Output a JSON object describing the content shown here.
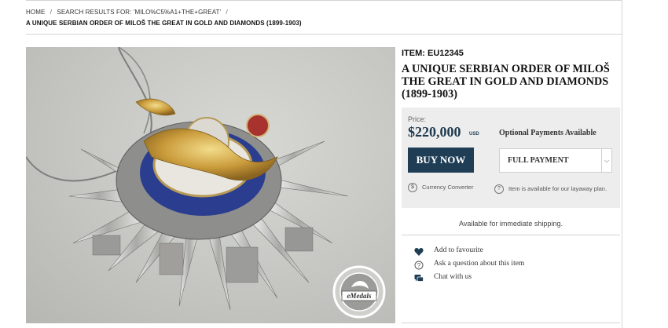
{
  "breadcrumb": {
    "home": "HOME",
    "separator": "/",
    "search": "SEARCH RESULTS FOR: 'MILO%C5%A1+THE+GREAT'",
    "current": "A UNIQUE SERBIAN ORDER OF MILOŠ THE GREAT IN GOLD AND DIAMONDS (1899-1903)"
  },
  "product": {
    "item_id": "ITEM: EU12345",
    "title": "A UNIQUE SERBIAN ORDER OF MILOŠ THE GREAT IN GOLD AND DIAMONDS (1899-1903)",
    "watermark": "eMedals"
  },
  "purchase": {
    "price_label": "Price:",
    "price": "$220,000",
    "currency": "USD",
    "optional_label": "Optional Payments Available",
    "buy_label": "BUY NOW",
    "payment_selected": "FULL PAYMENT",
    "currency_converter": "Currency Converter",
    "layaway_note": "Item is available for our layaway plan.",
    "availability": "Available for immediate shipping."
  },
  "actions": [
    {
      "label": "Add to favourite",
      "icon": "heart-icon"
    },
    {
      "label": "Ask a question about this item",
      "icon": "question-icon"
    },
    {
      "label": "Chat with us",
      "icon": "chat-icon"
    }
  ],
  "colors": {
    "accent": "#1f3e55",
    "price": "#1e3a4f",
    "panel": "#ededed"
  }
}
